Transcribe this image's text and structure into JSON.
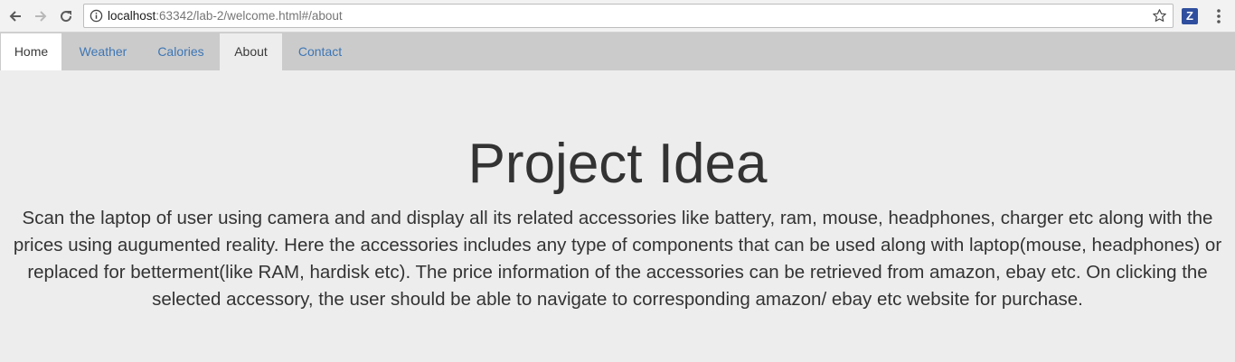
{
  "browser": {
    "url_host": "localhost",
    "url_path": ":63342/lab-2/welcome.html#/about",
    "extension_label": "Z"
  },
  "nav": {
    "tabs": [
      {
        "label": "Home",
        "state": "active"
      },
      {
        "label": "Weather",
        "state": "link"
      },
      {
        "label": "Calories",
        "state": "link"
      },
      {
        "label": "About",
        "state": "current"
      },
      {
        "label": "Contact",
        "state": "link"
      }
    ]
  },
  "content": {
    "title": "Project Idea",
    "description": "Scan the laptop of user using camera and and display all its related accessories like battery, ram, mouse, headphones, charger etc along with the prices using augumented reality. Here the accessories includes any type of components that can be used along with laptop(mouse, headphones) or replaced for betterment(like RAM, hardisk etc). The price information of the accessories can be retrieved from amazon, ebay etc. On clicking the selected accessory, the user should be able to navigate to corresponding amazon/ ebay etc website for purchase."
  },
  "colors": {
    "navbar_bg": "#cbcbcb",
    "page_bg": "#ededed",
    "link": "#3d76b5",
    "text": "#333333"
  }
}
